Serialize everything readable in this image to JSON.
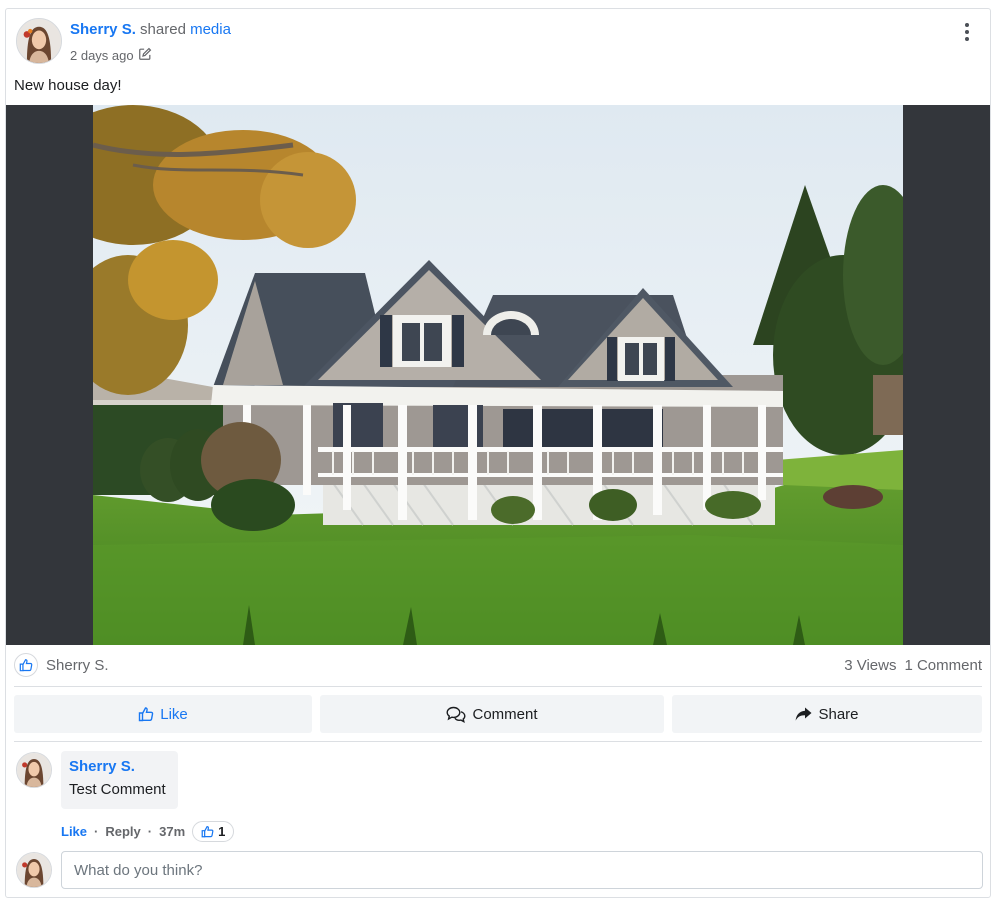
{
  "post": {
    "author": "Sherry S.",
    "shared_text": "shared",
    "media_link": "media",
    "time": "2 days ago",
    "text": "New house day!",
    "menu_icon": "ellipsis-vertical-icon"
  },
  "stats": {
    "liker": "Sherry S.",
    "views": "3 Views",
    "comments": "1 Comment"
  },
  "actions": {
    "like": "Like",
    "comment": "Comment",
    "share": "Share"
  },
  "comment": {
    "author": "Sherry S.",
    "text": "Test Comment",
    "like": "Like",
    "reply": "Reply",
    "time": "37m",
    "reactions": "1",
    "separator": "·"
  },
  "composer": {
    "placeholder": "What do you think?"
  },
  "colors": {
    "accent": "#1877f2",
    "media_bg": "#33363b"
  }
}
